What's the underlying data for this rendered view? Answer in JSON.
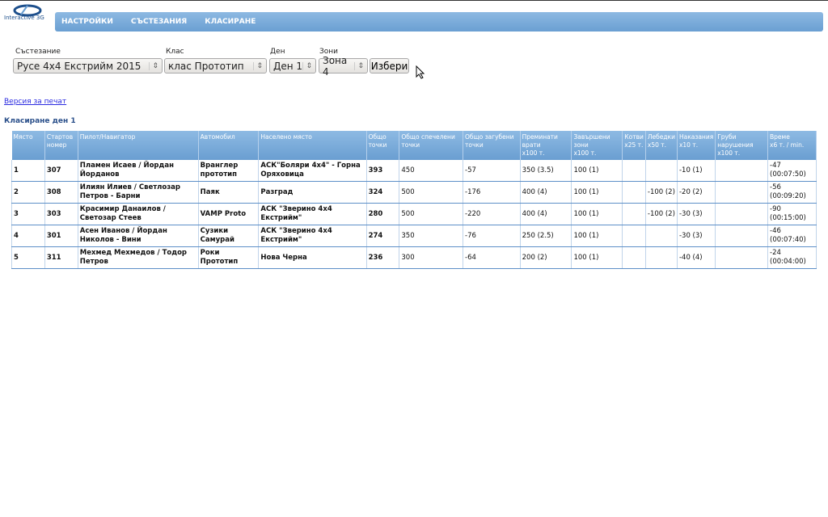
{
  "logo": {
    "text": "Interactive 3G"
  },
  "nav": [
    "НАСТРОЙКИ",
    "СЪСТЕЗАНИЯ",
    "КЛАСИРАНЕ"
  ],
  "filters": {
    "competition": {
      "label": "Състезание",
      "value": "Русе 4x4 Екстрийм 2015"
    },
    "class": {
      "label": "Клас",
      "value": "клас Прототип"
    },
    "day": {
      "label": "Ден",
      "value": "Ден 1"
    },
    "zones": {
      "label": "Зони",
      "value": "Зона 4"
    },
    "submit": "Избери"
  },
  "print_link": "Версия за печат",
  "section_title": "Класиране ден 1",
  "table": {
    "headers": [
      [
        "Място"
      ],
      [
        "Стартов",
        "номер"
      ],
      [
        "Пилот/Навигатор"
      ],
      [
        "Автомобил"
      ],
      [
        "Населено място"
      ],
      [
        "Общо",
        "точки"
      ],
      [
        "Общо спечелени",
        "точки"
      ],
      [
        "Общо загубени",
        "точки"
      ],
      [
        "Преминати",
        "врати",
        "x100 т."
      ],
      [
        "Завършени",
        "зони",
        "x100 т."
      ],
      [
        "Котви",
        "x25 т."
      ],
      [
        "Лебедки",
        "x50 т."
      ],
      [
        "Наказания",
        "x10 т."
      ],
      [
        "Груби",
        "нарушения",
        "x100 т."
      ],
      [
        "Време",
        "x6 т. / min."
      ]
    ],
    "rows": [
      [
        "1",
        "307",
        "Пламен Исаев / Йордан Йорданов",
        "Вранглер прототип",
        "АСК\"Боляри 4x4\" - Горна Оряховица",
        "393",
        "450",
        "-57",
        "350 (3.5)",
        "100 (1)",
        "",
        "",
        "-10 (1)",
        "",
        "-47 (00:07:50)"
      ],
      [
        "2",
        "308",
        "Илиян Илиев / Светлозар Петров - Барни",
        "Паяк",
        "Разград",
        "324",
        "500",
        "-176",
        "400 (4)",
        "100 (1)",
        "",
        "-100 (2)",
        "-20 (2)",
        "",
        "-56 (00:09:20)"
      ],
      [
        "3",
        "303",
        "Красимир Данаилов / Светозар Стеев",
        "VAMP Proto",
        "АСК \"Зверино 4x4 Екстрийм\"",
        "280",
        "500",
        "-220",
        "400 (4)",
        "100 (1)",
        "",
        "-100 (2)",
        "-30 (3)",
        "",
        "-90 (00:15:00)"
      ],
      [
        "4",
        "301",
        "Асен Иванов / Йордан Николов - Вини",
        "Сузики Самурай",
        "АСК \"Зверино 4x4 Екстрийм\"",
        "274",
        "350",
        "-76",
        "250 (2.5)",
        "100 (1)",
        "",
        "",
        "-30 (3)",
        "",
        "-46 (00:07:40)"
      ],
      [
        "5",
        "311",
        "Мехмед Мехмедов / Тодор Петров",
        "Роки Прототип",
        "Нова Черна",
        "236",
        "300",
        "-64",
        "200 (2)",
        "100 (1)",
        "",
        "",
        "-40 (4)",
        "",
        "-24 (00:04:00)"
      ]
    ]
  }
}
